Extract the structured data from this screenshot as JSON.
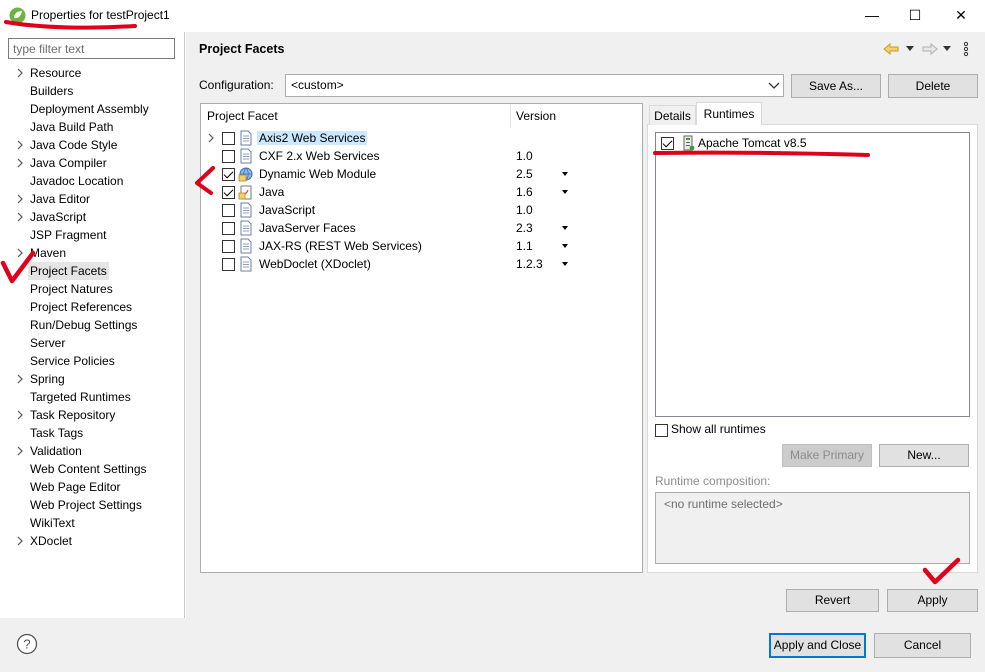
{
  "window": {
    "title": "Properties for testProject1",
    "controls": {
      "minimize": "—",
      "maximize": "☐",
      "close": "✕"
    }
  },
  "sidebar": {
    "filter_placeholder": "type filter text",
    "items": [
      {
        "label": "Resource",
        "expandable": true
      },
      {
        "label": "Builders",
        "expandable": false
      },
      {
        "label": "Deployment Assembly",
        "expandable": false
      },
      {
        "label": "Java Build Path",
        "expandable": false
      },
      {
        "label": "Java Code Style",
        "expandable": true
      },
      {
        "label": "Java Compiler",
        "expandable": true
      },
      {
        "label": "Javadoc Location",
        "expandable": false
      },
      {
        "label": "Java Editor",
        "expandable": true
      },
      {
        "label": "JavaScript",
        "expandable": true
      },
      {
        "label": "JSP Fragment",
        "expandable": false
      },
      {
        "label": "Maven",
        "expandable": true
      },
      {
        "label": "Project Facets",
        "expandable": false,
        "selected": true
      },
      {
        "label": "Project Natures",
        "expandable": false
      },
      {
        "label": "Project References",
        "expandable": false
      },
      {
        "label": "Run/Debug Settings",
        "expandable": false
      },
      {
        "label": "Server",
        "expandable": false
      },
      {
        "label": "Service Policies",
        "expandable": false
      },
      {
        "label": "Spring",
        "expandable": true
      },
      {
        "label": "Targeted Runtimes",
        "expandable": false
      },
      {
        "label": "Task Repository",
        "expandable": true
      },
      {
        "label": "Task Tags",
        "expandable": false
      },
      {
        "label": "Validation",
        "expandable": true
      },
      {
        "label": "Web Content Settings",
        "expandable": false
      },
      {
        "label": "Web Page Editor",
        "expandable": false
      },
      {
        "label": "Web Project Settings",
        "expandable": false
      },
      {
        "label": "WikiText",
        "expandable": false
      },
      {
        "label": "XDoclet",
        "expandable": true
      }
    ]
  },
  "page": {
    "title": "Project Facets",
    "configuration_label": "Configuration:",
    "configuration_value": "<custom>",
    "save_as_label": "Save As...",
    "delete_label": "Delete"
  },
  "facets": {
    "header_facet": "Project Facet",
    "header_version": "Version",
    "rows": [
      {
        "name": "Axis2 Web Services",
        "version": "",
        "checked": false,
        "expandable": true,
        "highlighted": true,
        "has_dropdown": false
      },
      {
        "name": "CXF 2.x Web Services",
        "version": "1.0",
        "checked": false,
        "expandable": false,
        "highlighted": false,
        "has_dropdown": false
      },
      {
        "name": "Dynamic Web Module",
        "version": "2.5",
        "checked": true,
        "expandable": false,
        "highlighted": false,
        "has_dropdown": true
      },
      {
        "name": "Java",
        "version": "1.6",
        "checked": true,
        "expandable": false,
        "highlighted": false,
        "has_dropdown": true
      },
      {
        "name": "JavaScript",
        "version": "1.0",
        "checked": false,
        "expandable": false,
        "highlighted": false,
        "has_dropdown": false
      },
      {
        "name": "JavaServer Faces",
        "version": "2.3",
        "checked": false,
        "expandable": false,
        "highlighted": false,
        "has_dropdown": true
      },
      {
        "name": "JAX-RS (REST Web Services)",
        "version": "1.1",
        "checked": false,
        "expandable": false,
        "highlighted": false,
        "has_dropdown": true
      },
      {
        "name": "WebDoclet (XDoclet)",
        "version": "1.2.3",
        "checked": false,
        "expandable": false,
        "highlighted": false,
        "has_dropdown": true
      }
    ]
  },
  "runtimes_panel": {
    "tab_details": "Details",
    "tab_runtimes": "Runtimes",
    "runtimes": [
      {
        "name": "Apache Tomcat v8.5",
        "checked": true
      }
    ],
    "show_all_label": "Show all runtimes",
    "make_primary_label": "Make Primary",
    "new_label": "New...",
    "composition_label": "Runtime composition:",
    "composition_value": "<no runtime selected>"
  },
  "footer": {
    "revert_label": "Revert",
    "apply_label": "Apply",
    "apply_close_label": "Apply and Close",
    "cancel_label": "Cancel",
    "help_icon": "?"
  },
  "colors": {
    "annotation_red": "#e0001b",
    "selection_blue": "#0078d7",
    "highlight_row": "#cce8ff"
  }
}
